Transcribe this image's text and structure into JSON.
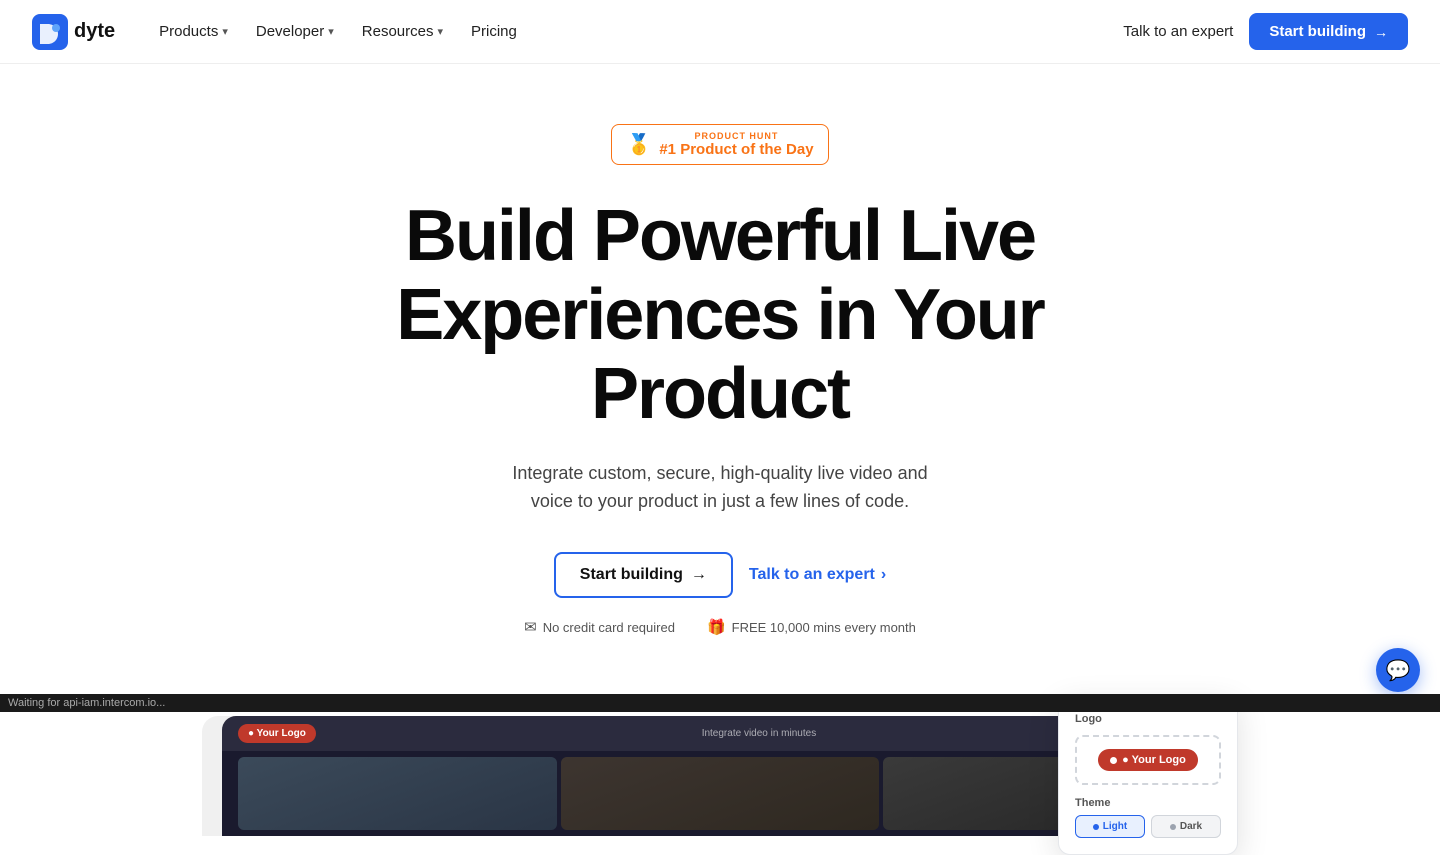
{
  "nav": {
    "logo_text": "dyte",
    "links": [
      {
        "label": "Products",
        "has_chevron": true
      },
      {
        "label": "Developer",
        "has_chevron": true
      },
      {
        "label": "Resources",
        "has_chevron": true
      },
      {
        "label": "Pricing",
        "has_chevron": false
      }
    ],
    "talk_label": "Talk to an expert",
    "start_label": "Start building",
    "start_arrow": "→"
  },
  "hero": {
    "badge": {
      "icon": "🥇",
      "label": "PRODUCT HUNT",
      "title": "#1 Product of the Day"
    },
    "heading_line1": "Build Powerful Live",
    "heading_line2": "Experiences in Your Product",
    "subtext": "Integrate custom, secure, high-quality live video and\nvoice to your product in just a few lines of code.",
    "cta_primary": "Start building",
    "cta_arrow": "→",
    "cta_secondary": "Talk to an expert",
    "cta_secondary_arrow": "›",
    "meta": [
      {
        "icon": "✉",
        "text": "No credit card required"
      },
      {
        "icon": "🎁",
        "text": "FREE 10,000 mins every month"
      }
    ]
  },
  "preview": {
    "logo_pill": "● Your Logo",
    "center_text": "Integrate video in minutes"
  },
  "customize_panel": {
    "logo_section": "Logo",
    "logo_preview": "● Your Logo",
    "theme_section": "Theme",
    "theme_light": "Light",
    "theme_dark": "Dark"
  },
  "chat": {
    "icon": "💬"
  },
  "status_bar": {
    "text": "Waiting for api-iam.intercom.io..."
  }
}
